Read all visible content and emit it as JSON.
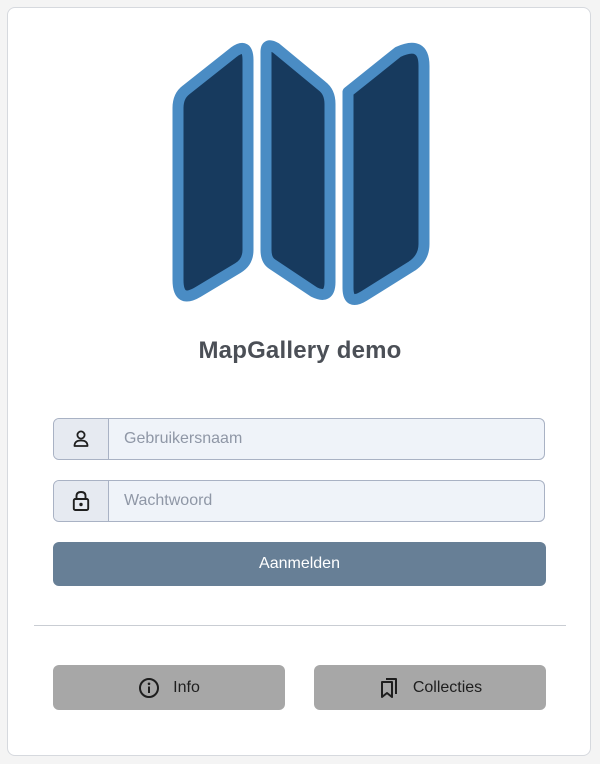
{
  "app": {
    "title": "MapGallery demo"
  },
  "login_form": {
    "username": {
      "value": "",
      "placeholder": "Gebruikersnaam",
      "icon": "user-icon"
    },
    "password": {
      "value": "",
      "placeholder": "Wachtwoord",
      "icon": "lock-icon"
    },
    "submit_label": "Aanmelden"
  },
  "footer": {
    "info": {
      "label": "Info",
      "icon": "info-icon"
    },
    "collections": {
      "label": "Collecties",
      "icon": "bookmarks-icon"
    }
  },
  "colors": {
    "logo_fill": "#173a5e",
    "logo_stroke": "#4a8cc4",
    "login_button": "#677f96",
    "footer_button": "#a7a7a7",
    "title_text": "#4b4f56"
  }
}
